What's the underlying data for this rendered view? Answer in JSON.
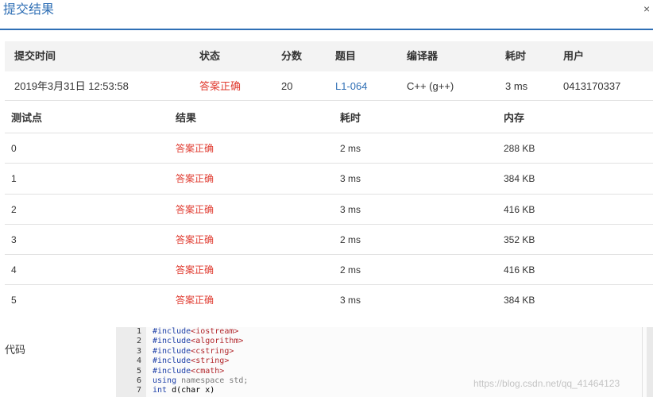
{
  "modal": {
    "title": "提交结果",
    "close": "×"
  },
  "summary": {
    "headers": [
      "提交时间",
      "状态",
      "分数",
      "题目",
      "编译器",
      "耗时",
      "用户"
    ],
    "row": {
      "time": "2019年3月31日 12:53:58",
      "status": "答案正确",
      "score": "20",
      "problem": "L1-064",
      "compiler": "C++ (g++)",
      "duration": "3 ms",
      "user": "0413170337"
    }
  },
  "tests": {
    "headers": [
      "测试点",
      "结果",
      "耗时",
      "内存"
    ],
    "rows": [
      {
        "id": "0",
        "result": "答案正确",
        "time": "2 ms",
        "memory": "288 KB"
      },
      {
        "id": "1",
        "result": "答案正确",
        "time": "3 ms",
        "memory": "384 KB"
      },
      {
        "id": "2",
        "result": "答案正确",
        "time": "3 ms",
        "memory": "416 KB"
      },
      {
        "id": "3",
        "result": "答案正确",
        "time": "2 ms",
        "memory": "352 KB"
      },
      {
        "id": "4",
        "result": "答案正确",
        "time": "2 ms",
        "memory": "416 KB"
      },
      {
        "id": "5",
        "result": "答案正确",
        "time": "3 ms",
        "memory": "384 KB"
      }
    ]
  },
  "code": {
    "label": "代码",
    "lines": [
      {
        "n": "1",
        "pre": "#include",
        "str": "<iostream>",
        "post": ""
      },
      {
        "n": "2",
        "pre": "#include",
        "str": "<algorithm>",
        "post": ""
      },
      {
        "n": "3",
        "pre": "#include",
        "str": "<cstring>",
        "post": ""
      },
      {
        "n": "4",
        "pre": "#include",
        "str": "<string>",
        "post": ""
      },
      {
        "n": "5",
        "pre": "#include",
        "str": "<cmath>",
        "post": ""
      },
      {
        "n": "6",
        "pre": "using",
        "str": "",
        "post": " namespace std;"
      },
      {
        "n": "7",
        "pre": "int",
        "str": "",
        "post": " d(char x)"
      }
    ]
  },
  "watermark": "https://blog.csdn.net/qq_41464123",
  "colors": {
    "accent": "#2f6fb5",
    "accepted": "#e03c31"
  }
}
